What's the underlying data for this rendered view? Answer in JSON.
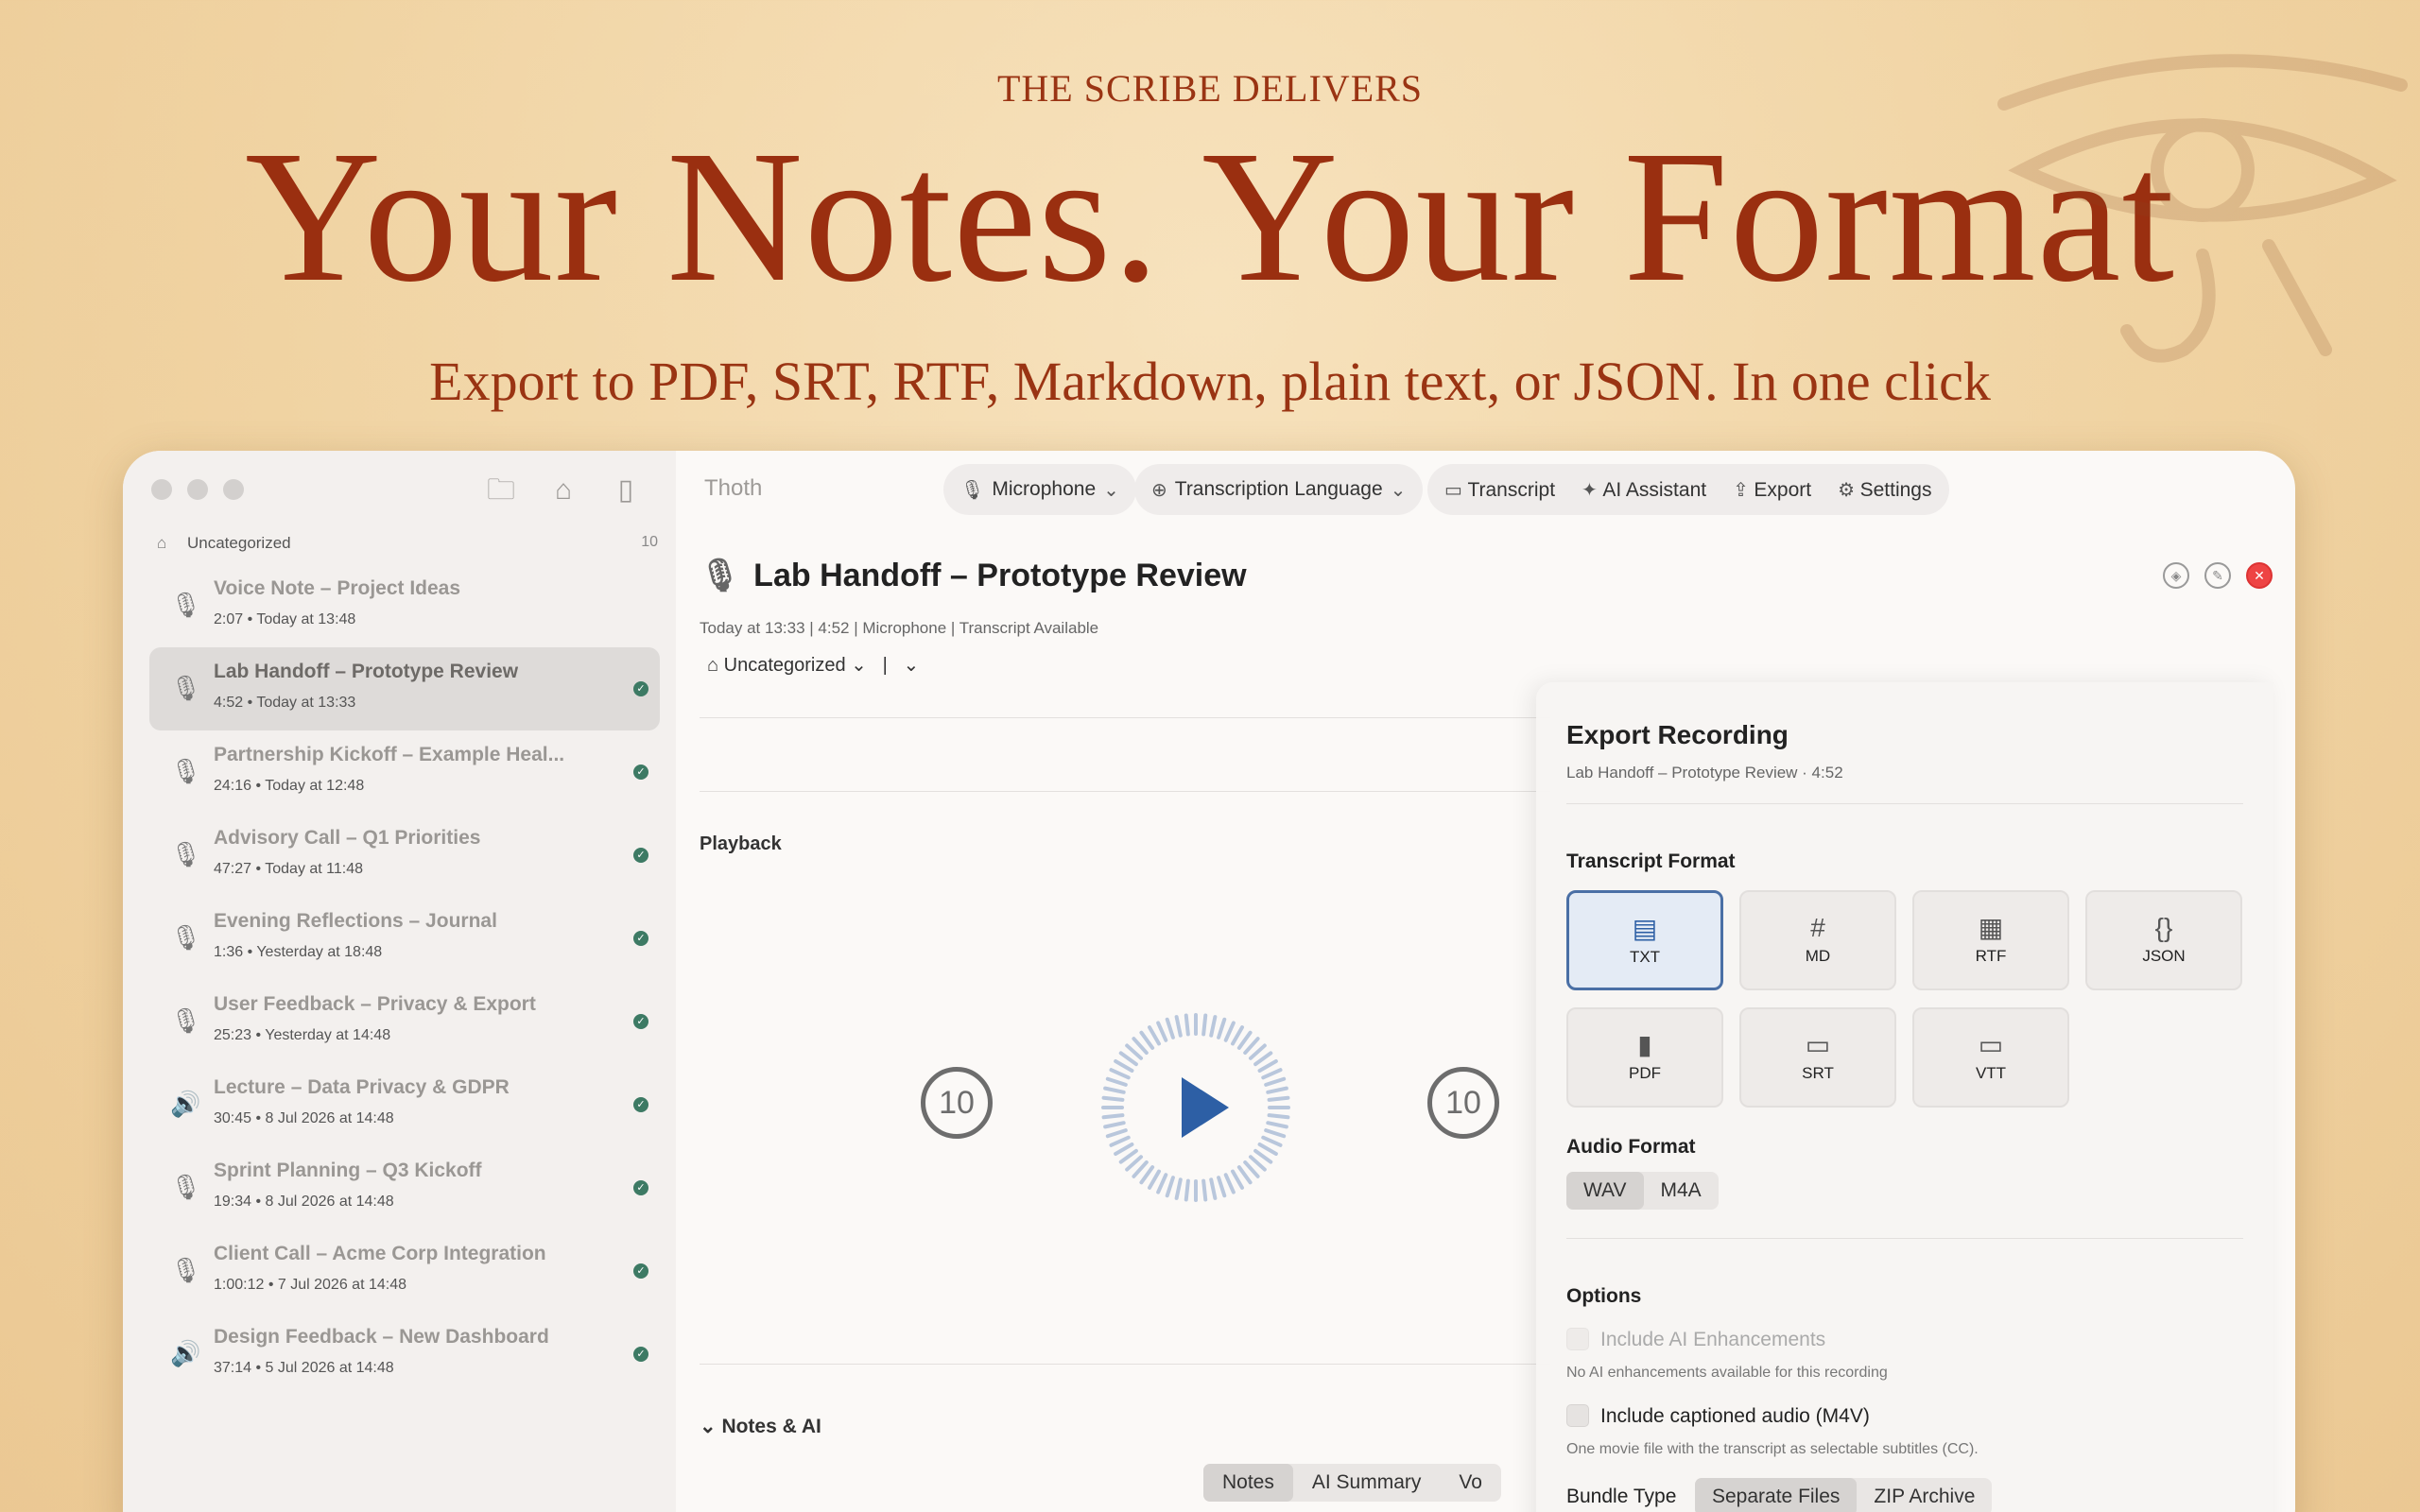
{
  "hero": {
    "kicker": "THE SCRIBE DELIVERS",
    "title": "Your Notes. Your Format",
    "subtitle": "Export to PDF, SRT, RTF, Markdown, plain text, or JSON. In one click"
  },
  "app": {
    "name": "Thoth"
  },
  "toolbar": {
    "microphone": "Microphone",
    "language": "Transcription Language",
    "transcript": "Transcript",
    "ai_assistant": "AI Assistant",
    "export": "Export",
    "settings": "Settings"
  },
  "sidebar": {
    "group": "Uncategorized",
    "count": "10",
    "items": [
      {
        "title": "Voice Note – Project Ideas",
        "duration": "2:07",
        "date": "Today at 13:48",
        "icon": "mic-icon",
        "transcribed": false
      },
      {
        "title": "Lab Handoff – Prototype Review",
        "duration": "4:52",
        "date": "Today at 13:33",
        "icon": "mic-icon",
        "transcribed": true,
        "selected": true
      },
      {
        "title": "Partnership Kickoff – Example Heal...",
        "duration": "24:16",
        "date": "Today at 12:48",
        "icon": "mic-multi-icon",
        "transcribed": true
      },
      {
        "title": "Advisory Call – Q1 Priorities",
        "duration": "47:27",
        "date": "Today at 11:48",
        "icon": "mic-multi-icon",
        "transcribed": true
      },
      {
        "title": "Evening Reflections – Journal",
        "duration": "1:36",
        "date": "Yesterday at 18:48",
        "icon": "mic-icon",
        "transcribed": true
      },
      {
        "title": "User Feedback – Privacy & Export",
        "duration": "25:23",
        "date": "Yesterday at 14:48",
        "icon": "mic-icon",
        "transcribed": true
      },
      {
        "title": "Lecture – Data Privacy & GDPR",
        "duration": "30:45",
        "date": "8 Jul 2026 at 14:48",
        "icon": "speaker-icon",
        "transcribed": true
      },
      {
        "title": "Sprint Planning – Q3 Kickoff",
        "duration": "19:34",
        "date": "8 Jul 2026 at 14:48",
        "icon": "mic-multi-icon",
        "transcribed": true
      },
      {
        "title": "Client Call – Acme Corp Integration",
        "duration": "1:00:12",
        "date": "7 Jul 2026 at 14:48",
        "icon": "mic-multi-icon",
        "transcribed": true
      },
      {
        "title": "Design Feedback – New Dashboard",
        "duration": "37:14",
        "date": "5 Jul 2026 at 14:48",
        "icon": "speaker-icon",
        "transcribed": true
      }
    ]
  },
  "detail": {
    "title": "Lab Handoff – Prototype Review",
    "meta": "Today at 13:33  |  4:52  |  Microphone  |  Transcript Available",
    "category": "Uncategorized",
    "playback_label": "Playback",
    "skip_back": "10",
    "skip_fwd": "10",
    "notes_label": "Notes & AI",
    "tabs": [
      "Notes",
      "AI Summary",
      "Vo"
    ]
  },
  "export_panel": {
    "title": "Export Recording",
    "subtitle": "Lab Handoff – Prototype Review  ·  4:52",
    "transcript_format_label": "Transcript Format",
    "formats": [
      {
        "label": "TXT",
        "icon": "doc-icon",
        "selected": true
      },
      {
        "label": "MD",
        "icon": "hash-icon"
      },
      {
        "label": "RTF",
        "icon": "rtf-icon"
      },
      {
        "label": "JSON",
        "icon": "braces-icon"
      },
      {
        "label": "PDF",
        "icon": "pdf-icon"
      },
      {
        "label": "SRT",
        "icon": "subtitle-icon"
      },
      {
        "label": "VTT",
        "icon": "subtitle-icon"
      }
    ],
    "audio_format_label": "Audio Format",
    "audio_formats": [
      "WAV",
      "M4A"
    ],
    "options_label": "Options",
    "opt1": "Include AI Enhancements",
    "opt1_note": "No AI enhancements available for this recording",
    "opt2": "Include captioned audio (M4V)",
    "opt2_note": "One movie file with the transcript as selectable subtitles (CC).",
    "bundle_label": "Bundle Type",
    "bundle_options": [
      "Separate Files",
      "ZIP Archive"
    ]
  },
  "colors": {
    "accent": "#9a2f10",
    "selection": "#4a6fa5",
    "check": "#3d7a64"
  }
}
